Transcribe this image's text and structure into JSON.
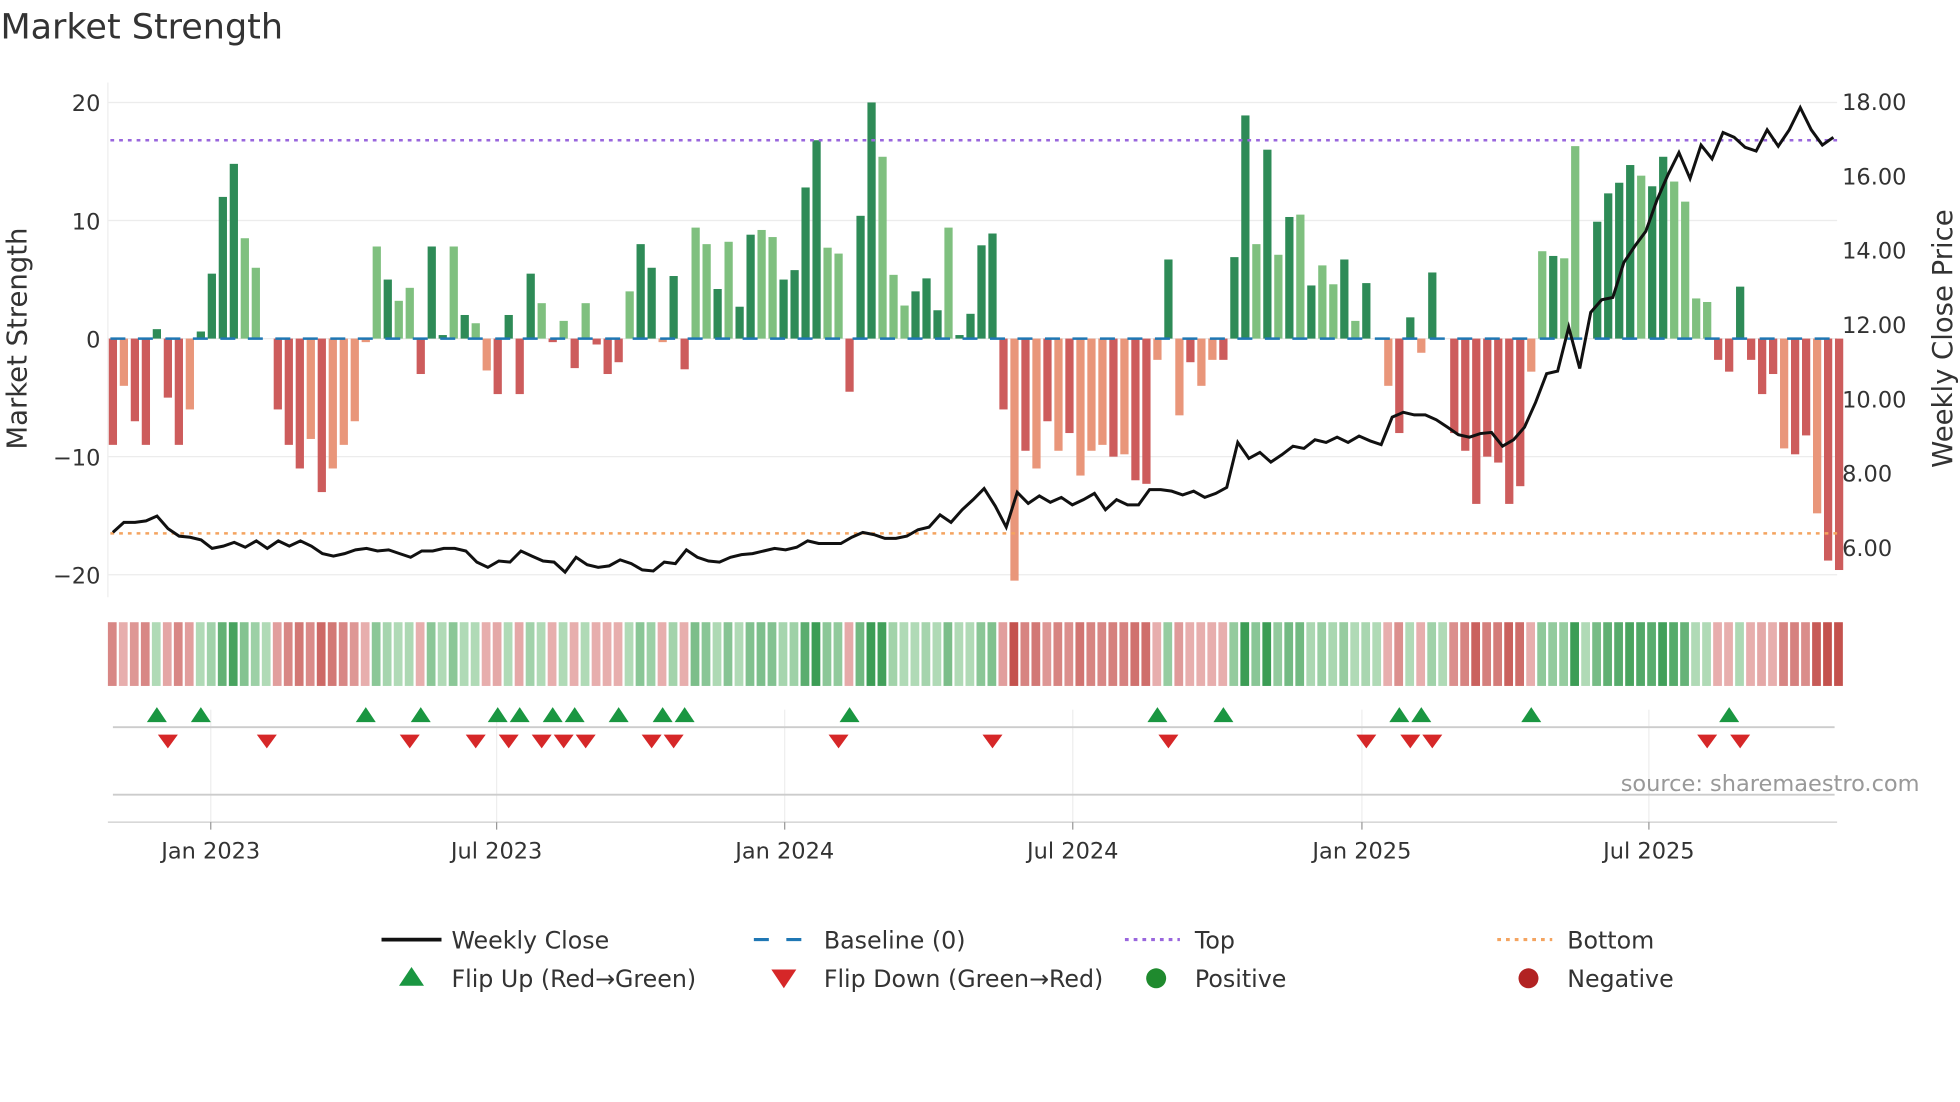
{
  "chart_data": {
    "type": "bar",
    "title": "Market Strength",
    "ylabel": "Market Strength",
    "y2label": "Weekly Close Price",
    "ylim": [
      -22,
      22
    ],
    "y2lim": [
      5.0,
      18.3
    ],
    "yticks": [
      "20",
      "10",
      "0",
      "−10",
      "−20"
    ],
    "ytick_values": [
      20,
      10,
      0,
      -10,
      -20
    ],
    "y2ticks": [
      "18.00",
      "16.00",
      "14.00",
      "12.00",
      "10.00",
      "8.00",
      "6.00"
    ],
    "y2tick_values": [
      18,
      16,
      14,
      12,
      10,
      8,
      6
    ],
    "x_ticks": [
      {
        "label": "Jan 2023",
        "week": 8.9
      },
      {
        "label": "Jul 2023",
        "week": 34.9
      },
      {
        "label": "Jan 2024",
        "week": 61.1
      },
      {
        "label": "Jul 2024",
        "week": 87.3
      },
      {
        "label": "Jan 2025",
        "week": 113.6
      },
      {
        "label": "Jul 2025",
        "week": 139.7
      }
    ],
    "top_level": 16.8,
    "bottom_level": -16.5,
    "baseline": 0,
    "strength": [
      -9,
      -4,
      -7,
      -9,
      0.8,
      -5,
      -9,
      -6,
      0.6,
      5.5,
      12,
      14.8,
      8.5,
      6,
      0,
      -6,
      -9,
      -11,
      -8.5,
      -13,
      -11,
      -9,
      -7,
      -0.3,
      7.8,
      5,
      3.2,
      4.3,
      -3,
      7.8,
      0.3,
      7.8,
      2,
      1.3,
      -2.7,
      -4.7,
      2,
      -4.7,
      5.5,
      3,
      -0.3,
      1.5,
      -2.5,
      3,
      -0.5,
      -3,
      -2,
      4,
      8,
      6,
      -0.3,
      5.3,
      -2.6,
      9.4,
      8,
      4.2,
      8.2,
      2.7,
      8.8,
      9.2,
      8.6,
      5,
      5.8,
      12.8,
      16.8,
      7.7,
      7.2,
      -4.5,
      10.4,
      20,
      15.4,
      5.4,
      2.8,
      4,
      5.1,
      2.4,
      9.4,
      0.3,
      2.1,
      7.9,
      8.9,
      -6,
      -20.5,
      -9.5,
      -11,
      -7,
      -9.5,
      -8,
      -11.6,
      -9.5,
      -9,
      -10,
      -9.8,
      -12,
      -12.3,
      -1.8,
      6.7,
      -6.5,
      -2,
      -4,
      -1.8,
      -1.8,
      6.9,
      18.9,
      8,
      16,
      7.1,
      10.3,
      10.5,
      4.5,
      6.2,
      4.6,
      6.7,
      1.5,
      4.7,
      0,
      -4,
      -8,
      1.8,
      -1.2,
      5.6,
      0,
      -8,
      -9.5,
      -14,
      -10,
      -10.5,
      -14,
      -12.5,
      -2.8,
      7.4,
      7,
      6.8,
      16.3,
      0,
      9.9,
      12.3,
      13.2,
      14.7,
      13.8,
      12.9,
      15.4,
      13.3,
      11.6,
      3.4,
      3.1,
      -1.8,
      -2.8,
      4.4,
      -1.8,
      -4.7,
      -3,
      -9.3,
      -9.8,
      -8.2,
      -14.8,
      -18.8,
      -19.6
    ],
    "tone": "dldddddlddddllddddldllllldlldddldllddddldldldddlddlddlldlddllddddlldddllldddldddddldldldllldlddldldlldddldldldlldlddlddldldddddddlldlldddddlddllllddddddlddlddd",
    "weekly_close": [
      6.4,
      6.67,
      6.67,
      6.71,
      6.84,
      6.5,
      6.3,
      6.27,
      6.2,
      5.97,
      6.03,
      6.13,
      6.0,
      6.17,
      5.97,
      6.17,
      6.03,
      6.17,
      6.03,
      5.83,
      5.76,
      5.83,
      5.93,
      5.97,
      5.9,
      5.93,
      5.83,
      5.73,
      5.9,
      5.9,
      5.97,
      5.97,
      5.9,
      5.6,
      5.46,
      5.63,
      5.6,
      5.9,
      5.76,
      5.63,
      5.6,
      5.33,
      5.73,
      5.53,
      5.46,
      5.5,
      5.66,
      5.56,
      5.39,
      5.36,
      5.6,
      5.56,
      5.93,
      5.73,
      5.63,
      5.6,
      5.73,
      5.8,
      5.83,
      5.9,
      5.97,
      5.93,
      6.0,
      6.17,
      6.1,
      6.1,
      6.1,
      6.27,
      6.4,
      6.34,
      6.24,
      6.24,
      6.3,
      6.47,
      6.54,
      6.87,
      6.67,
      7.01,
      7.28,
      7.58,
      7.11,
      6.54,
      7.48,
      7.18,
      7.38,
      7.21,
      7.34,
      7.14,
      7.28,
      7.45,
      7.01,
      7.28,
      7.14,
      7.14,
      7.55,
      7.55,
      7.51,
      7.41,
      7.51,
      7.34,
      7.45,
      7.61,
      8.82,
      8.39,
      8.55,
      8.29,
      8.49,
      8.72,
      8.66,
      8.89,
      8.82,
      8.96,
      8.82,
      8.99,
      8.86,
      8.76,
      9.5,
      9.63,
      9.56,
      9.56,
      9.43,
      9.23,
      9.03,
      8.96,
      9.06,
      9.09,
      8.72,
      8.89,
      9.23,
      9.9,
      10.67,
      10.74,
      11.92,
      10.81,
      12.32,
      12.66,
      12.72,
      13.66,
      14.1,
      14.5,
      15.34,
      16.02,
      16.62,
      15.92,
      16.82,
      16.45,
      17.16,
      17.03,
      16.76,
      16.66,
      17.23,
      16.79,
      17.23,
      17.83,
      17.23,
      16.82,
      17.03
    ],
    "flip_up_weeks": [
      4,
      8,
      23,
      28,
      35,
      37,
      40,
      42,
      46,
      50,
      52,
      67,
      95,
      101,
      117,
      119,
      129,
      147
    ],
    "flip_down_weeks": [
      5,
      14,
      27,
      33,
      36,
      39,
      41,
      43,
      49,
      51,
      66,
      80,
      96,
      114,
      118,
      120,
      145,
      148
    ],
    "legend": [
      {
        "label": "Weekly Close",
        "kind": "line",
        "color": "#111111"
      },
      {
        "label": "Baseline (0)",
        "kind": "dash",
        "color": "#1f77b4"
      },
      {
        "label": "Top",
        "kind": "dot",
        "color": "#9966dd"
      },
      {
        "label": "Bottom",
        "kind": "dot",
        "color": "#f4a460"
      },
      {
        "label": "Flip Up (Red→Green)",
        "kind": "up",
        "color": "#1a9641"
      },
      {
        "label": "Flip Down (Green→Red)",
        "kind": "down",
        "color": "#d62728"
      },
      {
        "label": "Positive",
        "kind": "circle",
        "color": "#1f8a2e"
      },
      {
        "label": "Negative",
        "kind": "circle",
        "color": "#b22222"
      }
    ],
    "colors": {
      "pos_dark": "#2e8b57",
      "pos_light": "#7fc07f",
      "neg_dark": "#cd5c5c",
      "neg_light": "#e9967a",
      "top": "#9966dd",
      "bottom": "#f4a460",
      "baseline": "#1f77b4"
    },
    "source": "source: sharemaestro.com"
  }
}
